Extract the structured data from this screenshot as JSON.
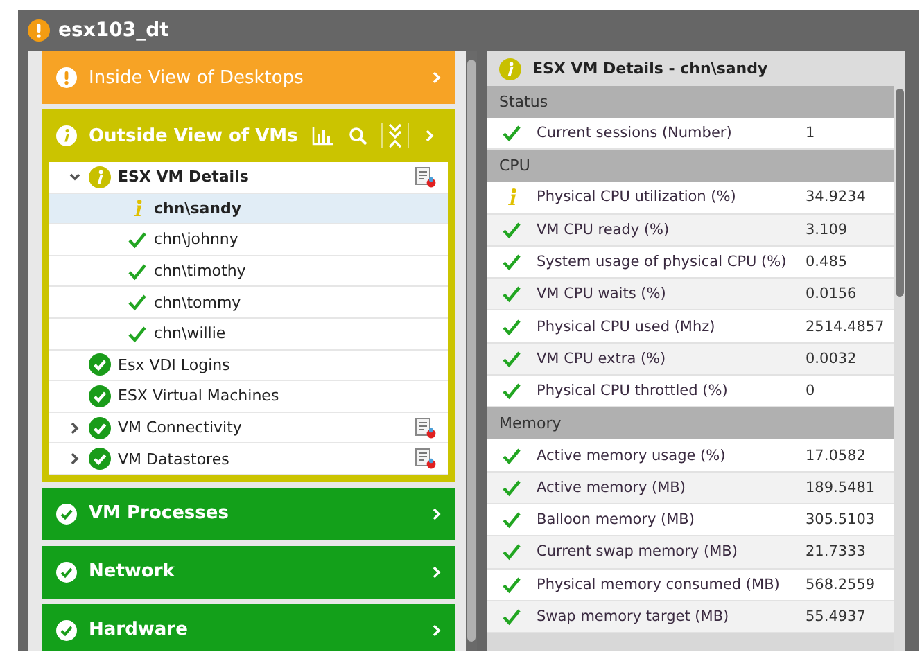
{
  "window": {
    "title": "esx103_dt",
    "kind": "warning"
  },
  "layers": [
    {
      "title": "Inside View of Desktops",
      "kind": "warning",
      "expanded": false
    },
    {
      "title": "Outside View of VMs",
      "kind": "info",
      "expanded": true,
      "tree": [
        {
          "label": "ESX VM Details",
          "kind": "info",
          "expanded": true,
          "report": true,
          "selected": false,
          "children": [
            {
              "label": "chn\\sandy",
              "kind": "info",
              "selected": true
            },
            {
              "label": "chn\\johnny",
              "kind": "ok",
              "selected": false
            },
            {
              "label": "chn\\timothy",
              "kind": "ok",
              "selected": false
            },
            {
              "label": "chn\\tommy",
              "kind": "ok",
              "selected": false
            },
            {
              "label": "chn\\willie",
              "kind": "ok",
              "selected": false
            }
          ]
        },
        {
          "label": "Esx VDI Logins",
          "kind": "ok",
          "report": false,
          "selected": false
        },
        {
          "label": "ESX Virtual Machines",
          "kind": "ok",
          "report": false,
          "selected": false
        },
        {
          "label": "VM Connectivity",
          "kind": "ok",
          "expanded": false,
          "report": true,
          "selected": false
        },
        {
          "label": "VM Datastores",
          "kind": "ok",
          "expanded": false,
          "report": true,
          "selected": false
        }
      ]
    },
    {
      "title": "VM Processes",
      "kind": "ok",
      "expanded": false
    },
    {
      "title": "Network",
      "kind": "ok",
      "expanded": false
    },
    {
      "title": "Hardware",
      "kind": "ok",
      "expanded": false
    }
  ],
  "details": {
    "title": "ESX VM Details - chn\\sandy",
    "kind": "info",
    "sections": [
      {
        "name": "Status",
        "rows": [
          {
            "label": "Current sessions (Number)",
            "value": "1",
            "kind": "ok"
          }
        ]
      },
      {
        "name": "CPU",
        "rows": [
          {
            "label": "Physical CPU utilization (%)",
            "value": "34.9234",
            "kind": "info"
          },
          {
            "label": "VM CPU ready (%)",
            "value": "3.109",
            "kind": "ok"
          },
          {
            "label": "System usage of physical CPU (%)",
            "value": "0.485",
            "kind": "ok"
          },
          {
            "label": "VM CPU waits (%)",
            "value": "0.0156",
            "kind": "ok"
          },
          {
            "label": "Physical CPU used (Mhz)",
            "value": "2514.4857",
            "kind": "ok"
          },
          {
            "label": "VM CPU extra (%)",
            "value": "0.0032",
            "kind": "ok"
          },
          {
            "label": "Physical CPU throttled (%)",
            "value": "0",
            "kind": "ok"
          }
        ]
      },
      {
        "name": "Memory",
        "rows": [
          {
            "label": "Active memory usage (%)",
            "value": "17.0582",
            "kind": "ok"
          },
          {
            "label": "Active memory (MB)",
            "value": "189.5481",
            "kind": "ok"
          },
          {
            "label": "Balloon memory (MB)",
            "value": "305.5103",
            "kind": "ok"
          },
          {
            "label": "Current swap memory (MB)",
            "value": "21.7333",
            "kind": "ok"
          },
          {
            "label": "Physical memory consumed (MB)",
            "value": "568.2559",
            "kind": "ok"
          },
          {
            "label": "Swap memory target (MB)",
            "value": "55.4937",
            "kind": "ok"
          }
        ]
      }
    ]
  }
}
